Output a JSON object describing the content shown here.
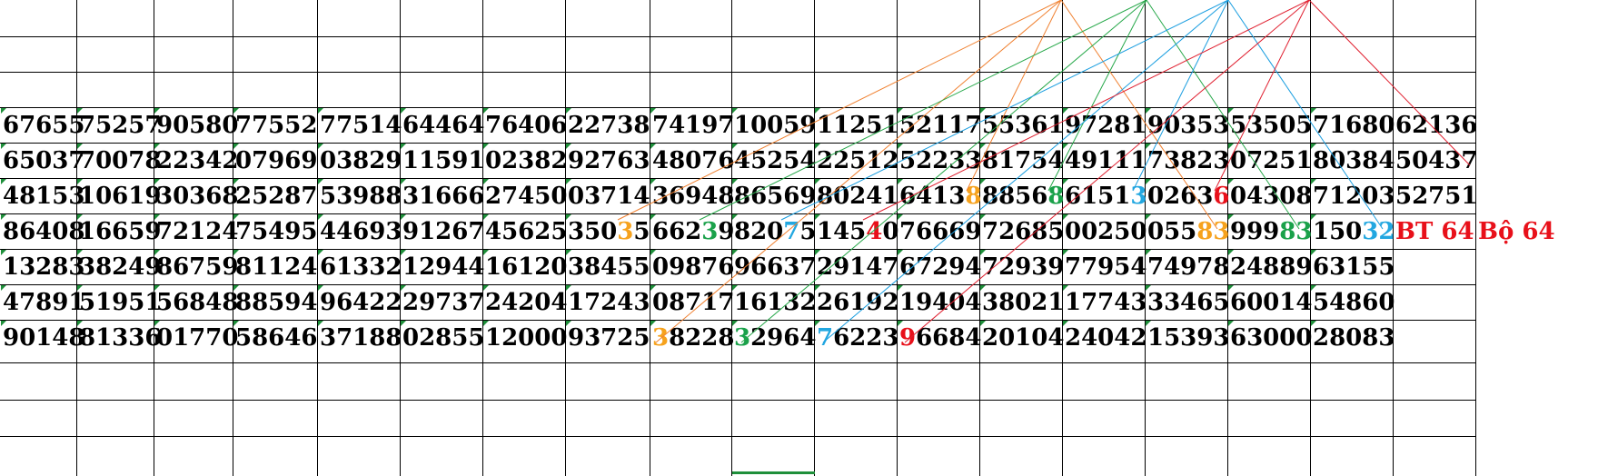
{
  "sheet": {
    "rows": [
      {
        "cells": [
          [
            {
              "t": "67655"
            }
          ],
          [
            {
              "t": "75257"
            }
          ],
          [
            {
              "t": "90580"
            }
          ],
          [
            {
              "t": "77552"
            }
          ],
          [
            {
              "t": "77514"
            }
          ],
          [
            {
              "t": "64464"
            }
          ],
          [
            {
              "t": "76406"
            }
          ],
          [
            {
              "t": "22738"
            }
          ],
          [
            {
              "t": "74197"
            }
          ],
          [
            {
              "t": "10059"
            }
          ],
          [
            {
              "t": "11251"
            }
          ],
          [
            {
              "t": "52117"
            }
          ],
          [
            {
              "t": "55361"
            }
          ],
          [
            {
              "t": "97281"
            }
          ],
          [
            {
              "t": "90353"
            }
          ],
          [
            {
              "t": "53505"
            }
          ],
          [
            {
              "t": "71680"
            }
          ],
          [
            {
              "t": "62136"
            }
          ],
          []
        ]
      },
      {
        "cells": [
          [
            {
              "t": "65037"
            }
          ],
          [
            {
              "t": "70078"
            }
          ],
          [
            {
              "t": "22342"
            }
          ],
          [
            {
              "t": "07969"
            }
          ],
          [
            {
              "t": "03829"
            }
          ],
          [
            {
              "t": "11591"
            }
          ],
          [
            {
              "t": "02382"
            }
          ],
          [
            {
              "t": "92763"
            }
          ],
          [
            {
              "t": "48076"
            }
          ],
          [
            {
              "t": "45254"
            }
          ],
          [
            {
              "t": "22512"
            }
          ],
          [
            {
              "t": "52233"
            }
          ],
          [
            {
              "t": "81754"
            }
          ],
          [
            {
              "t": "49111"
            }
          ],
          [
            {
              "t": "73823"
            }
          ],
          [
            {
              "t": "07251"
            }
          ],
          [
            {
              "t": "80384"
            }
          ],
          [
            {
              "t": "50437"
            }
          ],
          []
        ]
      },
      {
        "cells": [
          [
            {
              "t": "48153"
            }
          ],
          [
            {
              "t": "10619"
            }
          ],
          [
            {
              "t": "30368"
            }
          ],
          [
            {
              "t": "25287"
            }
          ],
          [
            {
              "t": "53988"
            }
          ],
          [
            {
              "t": "31666"
            }
          ],
          [
            {
              "t": "27450"
            }
          ],
          [
            {
              "t": "03714"
            }
          ],
          [
            {
              "t": "36948"
            }
          ],
          [
            {
              "t": "86569"
            }
          ],
          [
            {
              "t": "80241"
            }
          ],
          [
            {
              "t": "6413"
            },
            {
              "t": "8",
              "c": "orange"
            }
          ],
          [
            {
              "t": "8856"
            },
            {
              "t": "8",
              "c": "green"
            }
          ],
          [
            {
              "t": "6151"
            },
            {
              "t": "3",
              "c": "blue"
            }
          ],
          [
            {
              "t": "0263"
            },
            {
              "t": "6",
              "c": "red"
            }
          ],
          [
            {
              "t": "04308"
            }
          ],
          [
            {
              "t": "71203"
            }
          ],
          [
            {
              "t": "52751"
            }
          ],
          []
        ]
      },
      {
        "cells": [
          [
            {
              "t": "86408"
            }
          ],
          [
            {
              "t": "16659"
            }
          ],
          [
            {
              "t": "72124"
            }
          ],
          [
            {
              "t": "75495"
            }
          ],
          [
            {
              "t": "44693"
            }
          ],
          [
            {
              "t": "91267"
            }
          ],
          [
            {
              "t": "45625"
            }
          ],
          [
            {
              "t": "350"
            },
            {
              "t": "3",
              "c": "orange"
            },
            {
              "t": "5"
            }
          ],
          [
            {
              "t": "662"
            },
            {
              "t": "3",
              "c": "green"
            },
            {
              "t": "9"
            }
          ],
          [
            {
              "t": "820"
            },
            {
              "t": "7",
              "c": "blue"
            },
            {
              "t": "5"
            }
          ],
          [
            {
              "t": "145"
            },
            {
              "t": "4",
              "c": "red"
            },
            {
              "t": "0"
            }
          ],
          [
            {
              "t": "76669"
            }
          ],
          [
            {
              "t": "72685"
            }
          ],
          [
            {
              "t": "00250"
            }
          ],
          [
            {
              "t": "055"
            },
            {
              "t": "83",
              "c": "orange"
            }
          ],
          [
            {
              "t": "999"
            },
            {
              "t": "83",
              "c": "green"
            }
          ],
          [
            {
              "t": "150"
            },
            {
              "t": "32",
              "c": "blue"
            }
          ],
          [
            {
              "t": "BT 64",
              "c": "red"
            }
          ],
          [
            {
              "t": "Bộ 64",
              "c": "red"
            }
          ]
        ]
      },
      {
        "cells": [
          [
            {
              "t": "13283"
            }
          ],
          [
            {
              "t": "38249"
            }
          ],
          [
            {
              "t": "86759"
            }
          ],
          [
            {
              "t": "81124"
            }
          ],
          [
            {
              "t": "61332"
            }
          ],
          [
            {
              "t": "12944"
            }
          ],
          [
            {
              "t": "16120"
            }
          ],
          [
            {
              "t": "38455"
            }
          ],
          [
            {
              "t": "09876"
            }
          ],
          [
            {
              "t": "96637"
            }
          ],
          [
            {
              "t": "29147"
            }
          ],
          [
            {
              "t": "67294"
            }
          ],
          [
            {
              "t": "72939"
            }
          ],
          [
            {
              "t": "77954"
            }
          ],
          [
            {
              "t": "74978"
            }
          ],
          [
            {
              "t": "24889"
            }
          ],
          [
            {
              "t": "63155"
            }
          ],
          [],
          []
        ]
      },
      {
        "cells": [
          [
            {
              "t": "47891"
            }
          ],
          [
            {
              "t": "51951"
            }
          ],
          [
            {
              "t": "56848"
            }
          ],
          [
            {
              "t": "88594"
            }
          ],
          [
            {
              "t": "96422"
            }
          ],
          [
            {
              "t": "29737"
            }
          ],
          [
            {
              "t": "24204"
            }
          ],
          [
            {
              "t": "17243"
            }
          ],
          [
            {
              "t": "08717"
            }
          ],
          [
            {
              "t": "16132"
            }
          ],
          [
            {
              "t": "26192"
            }
          ],
          [
            {
              "t": "19404"
            }
          ],
          [
            {
              "t": "38021"
            }
          ],
          [
            {
              "t": "17743"
            }
          ],
          [
            {
              "t": "33465"
            }
          ],
          [
            {
              "t": "60014"
            }
          ],
          [
            {
              "t": "54860"
            }
          ],
          [],
          []
        ]
      },
      {
        "cells": [
          [
            {
              "t": "90148"
            }
          ],
          [
            {
              "t": "81336"
            }
          ],
          [
            {
              "t": "01770"
            }
          ],
          [
            {
              "t": "58646"
            }
          ],
          [
            {
              "t": "37188"
            }
          ],
          [
            {
              "t": "02855"
            }
          ],
          [
            {
              "t": "12000"
            }
          ],
          [
            {
              "t": "93725"
            }
          ],
          [
            {
              "t": "3",
              "c": "orange"
            },
            {
              "t": "8228"
            }
          ],
          [
            {
              "t": "3",
              "c": "green"
            },
            {
              "t": "2964"
            }
          ],
          [
            {
              "t": "7",
              "c": "blue"
            },
            {
              "t": "6223"
            }
          ],
          [
            {
              "t": "9",
              "c": "red"
            },
            {
              "t": "6684"
            }
          ],
          [
            {
              "t": "20104"
            }
          ],
          [
            {
              "t": "24042"
            }
          ],
          [
            {
              "t": "15393"
            }
          ],
          [
            {
              "t": "63000"
            }
          ],
          [
            {
              "t": "28083"
            }
          ],
          [],
          []
        ]
      }
    ]
  },
  "colors": {
    "orange": "#f6a21d",
    "green": "#1aa14a",
    "blue": "#22a7e0",
    "red": "#e8101a",
    "line_orange": "#f08030",
    "line_green": "#27a84a",
    "line_blue": "#1a9ee0",
    "line_red": "#e02030",
    "cell_marker": "#1e8f3a"
  }
}
